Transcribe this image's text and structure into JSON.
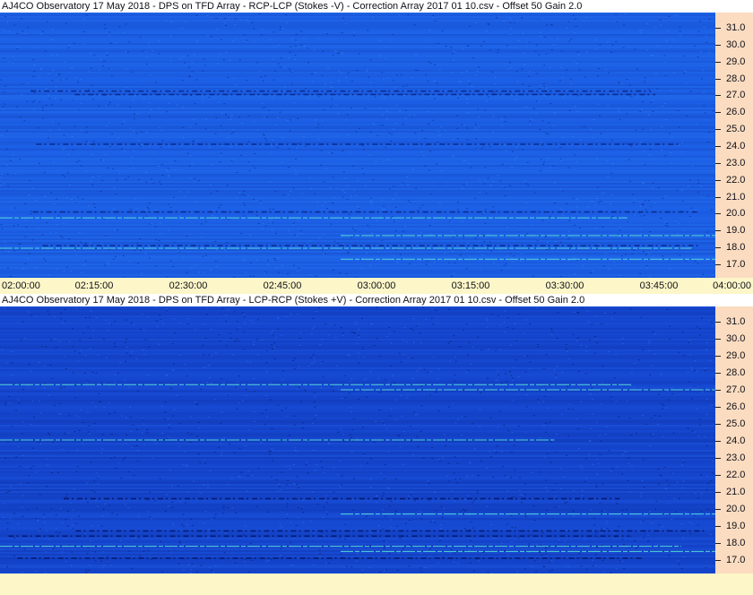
{
  "chart_data": [
    {
      "type": "heatmap",
      "title": "AJ4CO Observatory 17 May 2018  -  DPS on TFD Array  -  RCP-LCP (Stokes -V)  -  Correction Array 2017 01 10.csv  -  Offset 50  Gain 2.0",
      "x_start": "02:00:00",
      "x_end": "04:00:00",
      "x_ticks": [
        "02:00:00",
        "02:15:00",
        "02:30:00",
        "02:45:00",
        "03:00:00",
        "03:15:00",
        "03:30:00",
        "03:45:00",
        "04:00:00"
      ],
      "y_ticks": [
        "31.0",
        "30.0",
        "29.0",
        "28.0",
        "27.0",
        "26.0",
        "25.0",
        "24.0",
        "23.0",
        "22.0",
        "21.0",
        "20.0",
        "19.0",
        "18.0",
        "17.0"
      ],
      "ylim": [
        16.2,
        31.9
      ],
      "colors": {
        "base": "#1c5fe6",
        "light": "#2f86f4",
        "dark": "#0a2a8e",
        "bright": "#5ff0d8"
      },
      "bright_lines_mhz": [
        19.75,
        18.7,
        17.95,
        17.3
      ],
      "dark_lines_mhz": [
        27.25,
        27.05,
        24.1,
        20.1,
        18.1
      ]
    },
    {
      "type": "heatmap",
      "title": "AJ4CO Observatory 17 May 2018  -  DPS on TFD Array  -  LCP-RCP (Stokes +V)  -  Correction Array 2017 01 10.csv  -  Offset 50  Gain 2.0",
      "x_start": "02:00:00",
      "x_end": "04:00:00",
      "y_ticks": [
        "31.0",
        "30.0",
        "29.0",
        "28.0",
        "27.0",
        "26.0",
        "25.0",
        "24.0",
        "23.0",
        "22.0",
        "21.0",
        "20.0",
        "19.0",
        "18.0",
        "17.0"
      ],
      "ylim": [
        16.2,
        31.9
      ],
      "colors": {
        "base": "#1546cf",
        "light": "#2a6ef0",
        "dark": "#061a6e",
        "bright": "#5ff0d8"
      },
      "bright_lines_mhz": [
        27.3,
        27.0,
        24.05,
        19.7,
        17.8,
        17.5
      ],
      "dark_lines_mhz": [
        20.6,
        18.7,
        18.4,
        17.1
      ]
    }
  ]
}
